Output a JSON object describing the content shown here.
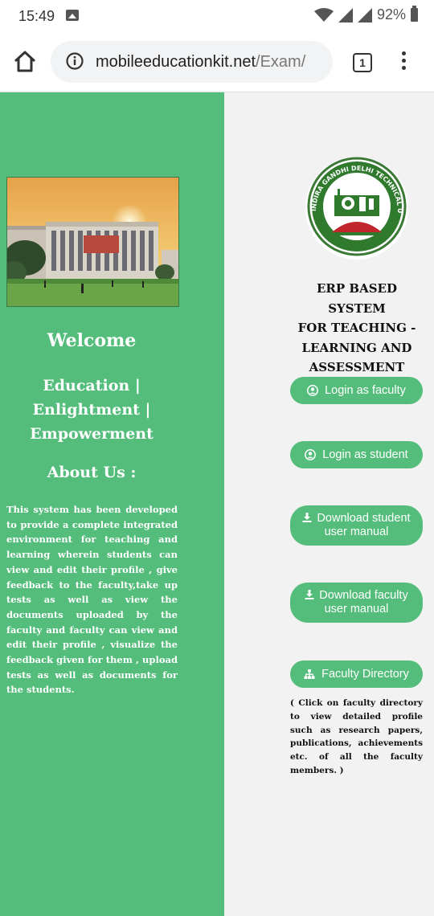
{
  "status_bar": {
    "time": "15:49",
    "battery": "92%"
  },
  "browser": {
    "url_host": "mobileeducationkit.net",
    "url_path": "/Exam/",
    "tab_count": "1"
  },
  "left_panel": {
    "welcome": "Welcome",
    "motto_line1": "Education |",
    "motto_line2": "Enlightment |",
    "motto_line3": "Empowerment",
    "about_title": "About Us :",
    "about_text": "This system has been developed to provide a complete integrated environment for teaching and learning wherein students can view and edit their profile , give feedback to the faculty,take up tests as well as view the documents uploaded by the faculty and faculty can view and edit their profile , visualize the feedback given for them , upload tests as well as documents for the students."
  },
  "right_panel": {
    "title_line1": "ERP BASED SYSTEM",
    "title_line2": "FOR TEACHING -",
    "title_line3": "LEARNING AND",
    "title_line4": "ASSESSMENT",
    "logo_text": "INDIRA GANDHI DELHI TECHNICAL UNIVERSITY FOR WOMEN",
    "buttons": {
      "login_faculty": "Login as faculty",
      "login_student": "Login as student",
      "download_student": "Download student user manual",
      "download_faculty": "Download faculty user manual",
      "faculty_directory": "Faculty Directory"
    },
    "note": "( Click on faculty directory to view detailed profile such as research papers, publications, achievements etc. of all the faculty members. )"
  },
  "colors": {
    "green": "#55bd7b",
    "right_bg": "#f2f2f2"
  },
  "icons": [
    "image-icon",
    "wifi-icon",
    "signal-icon",
    "battery-icon",
    "home-icon",
    "info-icon",
    "tab-switcher-icon",
    "more-vert-icon",
    "user-circle-icon",
    "download-icon",
    "sitemap-icon"
  ]
}
